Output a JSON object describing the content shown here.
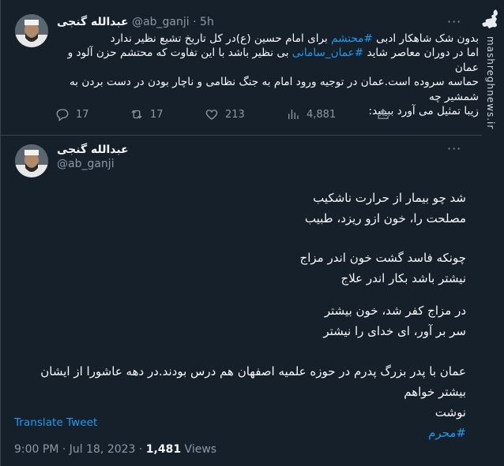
{
  "watermark": {
    "logo_text": "مشرق",
    "site": "mashreghnews.ir"
  },
  "tweet1": {
    "author_name": "عبدالله گنجی",
    "handle": "@ab_ganji",
    "separator": "·",
    "time": "5h",
    "body": {
      "line1_pre": "بدون شک شاهکار ادبی ",
      "line1_tag": "#محتشم",
      "line1_post": " برای امام حسین (ع)در کل تاریخ تشیع نظیر ندارد",
      "line2_pre": "اما در دوران معاصر شاید ",
      "line2_tag": "#عمان_سامانی",
      "line2_post": " بی نظیر باشد با این تفاوت که محتشم حزن آلود و عمان",
      "line3": "حماسه سروده است.عمان در توجیه ورود امام به جنگ نظامی و ناچار بودن در دست بردن به شمشیر چه",
      "line4": "زیبا تمثیل می آورد ببینید:"
    },
    "actions": {
      "replies": "17",
      "retweets": "17",
      "likes": "213",
      "views": "4,881"
    }
  },
  "tweet2": {
    "author_name": "عبدالله گنجی",
    "handle": "@ab_ganji",
    "more_label": "···",
    "poem": {
      "stanza1_l1": "شد چو بیمار از حرارت ناشکیب",
      "stanza1_l2": "مصلحت را، خون ازو ریزد، طبیب",
      "stanza2_l1": "چونکه فاسد گشت خون اندر مزاج",
      "stanza2_l2": "نیشتر باشد بکار اندر علاج",
      "stanza3_l1": "در مزاج کفر شد، خون بیشتر",
      "stanza3_l2": "سر بر آور، ای خدای را نیشتر",
      "para_l1": "عمان با پدر بزرگ پدرم در حوزه علمیه اصفهان هم درس بودند.در دهه عاشورا از ایشان بیشتر خواهم",
      "para_l2": "نوشت",
      "hashtag": "#محرم"
    },
    "translate_label": "Translate Tweet",
    "timestamp": "9:00 PM · Jul 18, 2023 · ",
    "views_count": "1,481",
    "views_label": " Views"
  }
}
